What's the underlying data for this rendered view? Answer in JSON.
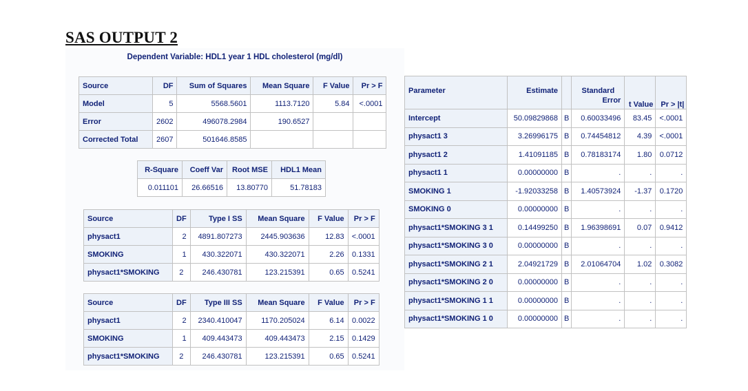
{
  "heading": "SAS OUTPUT 2",
  "dependent_variable": "Dependent Variable: HDL1 year 1 HDL cholesterol (mg/dl)",
  "anova": {
    "headers": [
      "Source",
      "DF",
      "Sum of Squares",
      "Mean Square",
      "F Value",
      "Pr > F"
    ],
    "rows": [
      {
        "source": "Model",
        "df": "5",
        "ss": "5568.5601",
        "ms": "1113.7120",
        "f": "5.84",
        "p": "<.0001"
      },
      {
        "source": "Error",
        "df": "2602",
        "ss": "496078.2984",
        "ms": "190.6527",
        "f": "",
        "p": ""
      },
      {
        "source": "Corrected Total",
        "df": "2607",
        "ss": "501646.8585",
        "ms": "",
        "f": "",
        "p": ""
      }
    ]
  },
  "fit": {
    "headers": [
      "R-Square",
      "Coeff Var",
      "Root MSE",
      "HDL1 Mean"
    ],
    "values": [
      "0.011101",
      "26.66516",
      "13.80770",
      "51.78183"
    ]
  },
  "type1": {
    "headers": [
      "Source",
      "DF",
      "Type I SS",
      "Mean Square",
      "F Value",
      "Pr > F"
    ],
    "rows": [
      {
        "source": "physact1",
        "df": "2",
        "ss": "4891.807273",
        "ms": "2445.903636",
        "f": "12.83",
        "p": "<.0001"
      },
      {
        "source": "SMOKING",
        "df": "1",
        "ss": "430.322071",
        "ms": "430.322071",
        "f": "2.26",
        "p": "0.1331"
      },
      {
        "source": "physact1*SMOKING",
        "df": "2",
        "ss": "246.430781",
        "ms": "123.215391",
        "f": "0.65",
        "p": "0.5241"
      }
    ]
  },
  "type3": {
    "headers": [
      "Source",
      "DF",
      "Type III SS",
      "Mean Square",
      "F Value",
      "Pr > F"
    ],
    "rows": [
      {
        "source": "physact1",
        "df": "2",
        "ss": "2340.410047",
        "ms": "1170.205024",
        "f": "6.14",
        "p": "0.0022"
      },
      {
        "source": "SMOKING",
        "df": "1",
        "ss": "409.443473",
        "ms": "409.443473",
        "f": "2.15",
        "p": "0.1429"
      },
      {
        "source": "physact1*SMOKING",
        "df": "2",
        "ss": "246.430781",
        "ms": "123.215391",
        "f": "0.65",
        "p": "0.5241"
      }
    ]
  },
  "params": {
    "headers": {
      "parameter": "Parameter",
      "estimate": "Estimate",
      "se_top": "Standard",
      "se_bottom": "Error",
      "t": "t Value",
      "p": "Pr > |t|"
    },
    "rows": [
      {
        "name": "Intercept",
        "est": "50.09829868",
        "flag": "B",
        "se": "0.60033496",
        "t": "83.45",
        "p": "<.0001"
      },
      {
        "name": "physact1 3",
        "est": "3.26996175",
        "flag": "B",
        "se": "0.74454812",
        "t": "4.39",
        "p": "<.0001"
      },
      {
        "name": "physact1 2",
        "est": "1.41091185",
        "flag": "B",
        "se": "0.78183174",
        "t": "1.80",
        "p": "0.0712"
      },
      {
        "name": "physact1 1",
        "est": "0.00000000",
        "flag": "B",
        "se": ".",
        "t": ".",
        "p": "."
      },
      {
        "name": "SMOKING 1",
        "est": "-1.92033258",
        "flag": "B",
        "se": "1.40573924",
        "t": "-1.37",
        "p": "0.1720"
      },
      {
        "name": "SMOKING 0",
        "est": "0.00000000",
        "flag": "B",
        "se": ".",
        "t": ".",
        "p": "."
      },
      {
        "name": "physact1*SMOKING 3 1",
        "est": "0.14499250",
        "flag": "B",
        "se": "1.96398691",
        "t": "0.07",
        "p": "0.9412"
      },
      {
        "name": "physact1*SMOKING 3 0",
        "est": "0.00000000",
        "flag": "B",
        "se": ".",
        "t": ".",
        "p": "."
      },
      {
        "name": "physact1*SMOKING 2 1",
        "est": "2.04921729",
        "flag": "B",
        "se": "2.01064704",
        "t": "1.02",
        "p": "0.3082"
      },
      {
        "name": "physact1*SMOKING 2 0",
        "est": "0.00000000",
        "flag": "B",
        "se": ".",
        "t": ".",
        "p": "."
      },
      {
        "name": "physact1*SMOKING 1 1",
        "est": "0.00000000",
        "flag": "B",
        "se": ".",
        "t": ".",
        "p": "."
      },
      {
        "name": "physact1*SMOKING 1 0",
        "est": "0.00000000",
        "flag": "B",
        "se": ".",
        "t": ".",
        "p": "."
      }
    ]
  }
}
